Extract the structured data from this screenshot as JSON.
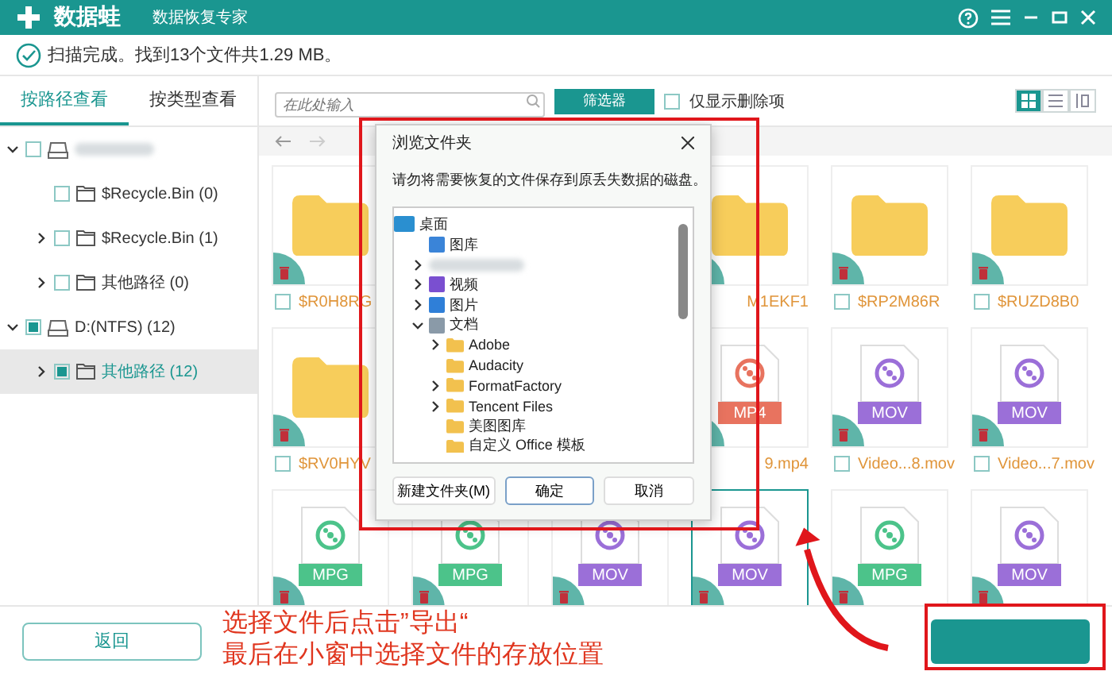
{
  "app": {
    "name": "数据蛙",
    "subtitle": "数据恢复专家"
  },
  "status": {
    "text": "扫描完成。找到13个文件共1.29 MB。"
  },
  "side_tabs": [
    {
      "label": "按路径查看",
      "selected": true
    },
    {
      "label": "按类型查看",
      "selected": false
    }
  ],
  "tree": [
    {
      "kind": "drive",
      "checked": false,
      "selected": false,
      "expanded": true,
      "children": [
        {
          "label": "$Recycle.Bin (0)",
          "kind": "folder",
          "checked": false,
          "selected": false,
          "expandable": false
        },
        {
          "label": "$Recycle.Bin (1)",
          "kind": "folder",
          "checked": false,
          "selected": false,
          "expandable": true
        },
        {
          "label": "其他路径 (0)",
          "kind": "folder",
          "checked": false,
          "selected": false,
          "expandable": true
        }
      ]
    },
    {
      "label": "D:(NTFS) (12)",
      "kind": "drive",
      "checked": true,
      "selected": false,
      "expanded": true,
      "children": [
        {
          "label": "其他路径 (12)",
          "kind": "folder",
          "checked": true,
          "selected": true,
          "expandable": true
        }
      ]
    }
  ],
  "toolbar": {
    "search": {
      "placeholder": "在此处输入"
    },
    "filter_button": "筛选器",
    "deleted_only": {
      "label": "仅显示删除项",
      "checked": false
    },
    "views": [
      {
        "selected": true
      },
      {
        "selected": false
      },
      {
        "selected": false
      }
    ]
  },
  "cards": [
    {
      "kind": "folder",
      "name": "$R0H8RG",
      "cut": false,
      "checked": false,
      "selected": false
    },
    {
      "kind": "hidden"
    },
    {
      "kind": "hidden"
    },
    {
      "kind": "folder",
      "name": "M1EKF1",
      "cut": true,
      "selected": false
    },
    {
      "kind": "folder",
      "name": "$RP2M86R",
      "cut": false,
      "checked": false,
      "selected": false
    },
    {
      "kind": "folder",
      "name": "$RUZD8B0",
      "cut": false,
      "checked": false,
      "selected": false
    },
    {
      "kind": "folder",
      "name": "$RV0HYV",
      "cut": false,
      "checked": false,
      "selected": false
    },
    {
      "kind": "hidden"
    },
    {
      "kind": "hidden"
    },
    {
      "kind": "video",
      "format": "MP4",
      "color": "#e8735f",
      "name": "9.mp4",
      "cut": true,
      "selected": false
    },
    {
      "kind": "video",
      "format": "MOV",
      "color": "#9b6fd8",
      "name": "Video...8.mov",
      "cut": false,
      "checked": false,
      "selected": false
    },
    {
      "kind": "video",
      "format": "MOV",
      "color": "#9b6fd8",
      "name": "Video...7.mov",
      "cut": false,
      "checked": false,
      "selected": false
    },
    {
      "kind": "video",
      "format": "MPG",
      "color": "#4cc38a",
      "selected": false
    },
    {
      "kind": "video",
      "format": "MPG",
      "color": "#4cc38a",
      "selected": false
    },
    {
      "kind": "video",
      "format": "MOV",
      "color": "#9b6fd8",
      "selected": false
    },
    {
      "kind": "video",
      "format": "MOV",
      "color": "#9b6fd8",
      "selected": true
    },
    {
      "kind": "video",
      "format": "MPG",
      "color": "#4cc38a",
      "selected": false
    },
    {
      "kind": "video",
      "format": "MOV",
      "color": "#9b6fd8",
      "selected": false
    }
  ],
  "back_button": "返回",
  "dialog": {
    "title": "浏览文件夹",
    "message": "请勿将需要恢复的文件保存到原丢失数据的磁盘。",
    "tree": [
      {
        "label": "桌面",
        "kind": "desktop",
        "children": [
          {
            "label": "图库",
            "kind": "gallery",
            "expandable": false
          },
          {
            "kind": "blurred",
            "expandable": true
          },
          {
            "label": "视频",
            "kind": "video",
            "expandable": true
          },
          {
            "label": "图片",
            "kind": "picture",
            "expandable": true
          },
          {
            "label": "文档",
            "kind": "docs",
            "expandable": true,
            "expanded": true,
            "children": [
              {
                "label": "Adobe",
                "kind": "folder",
                "expandable": true
              },
              {
                "label": "Audacity",
                "kind": "folder",
                "expandable": false
              },
              {
                "label": "FormatFactory",
                "kind": "folder",
                "expandable": true
              },
              {
                "label": "Tencent Files",
                "kind": "folder",
                "expandable": true
              },
              {
                "label": "美图图库",
                "kind": "folder",
                "expandable": false
              },
              {
                "label": "自定义 Office 模板",
                "kind": "folder",
                "expandable": false
              }
            ]
          }
        ]
      }
    ],
    "buttons": [
      {
        "label": "新建文件夹(M)",
        "primary": false
      },
      {
        "label": "确定",
        "primary": true
      },
      {
        "label": "取消",
        "primary": false
      }
    ]
  },
  "annotation": {
    "lines": [
      "选择文件后点击”导出“",
      "最后在小窗中选择文件的存放位置"
    ]
  }
}
